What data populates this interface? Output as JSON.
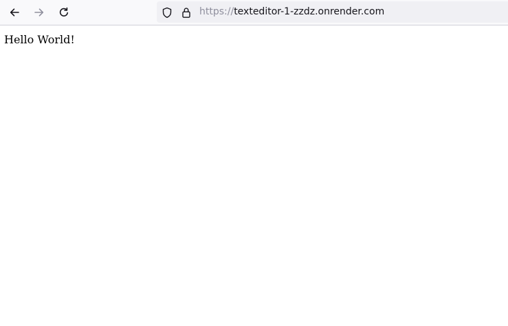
{
  "browser": {
    "url": {
      "scheme": "https://",
      "host": "texteditor-1-zzdz.onrender.com"
    },
    "icons": {
      "back": "back-arrow-icon",
      "forward": "forward-arrow-icon",
      "reload": "reload-icon",
      "tracking_protection": "shield-icon",
      "security": "lock-icon"
    },
    "colors": {
      "toolbar_bg": "#f9f9fb",
      "urlbar_bg": "#f0f0f4",
      "icon_active": "#15141a",
      "icon_disabled": "#8f8f9d"
    }
  },
  "page": {
    "body_text": "Hello World!"
  }
}
